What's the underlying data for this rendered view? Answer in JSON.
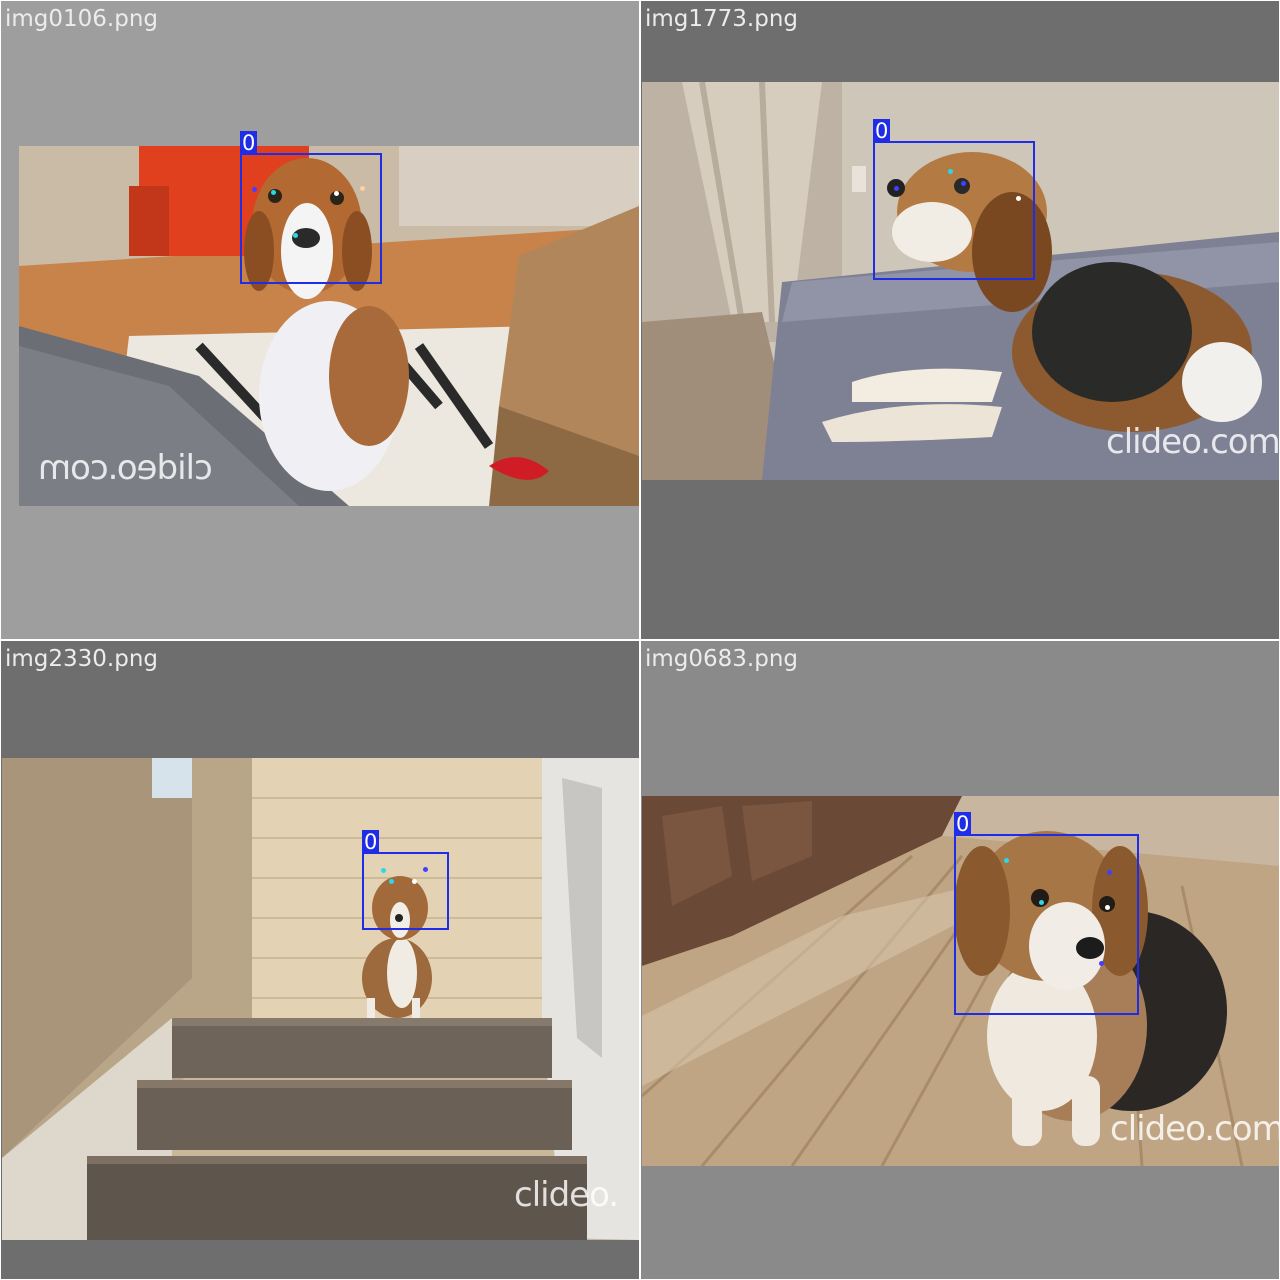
{
  "panels": [
    {
      "filename": "img0106.png",
      "watermark": "clideo.com",
      "detection_label": "0",
      "keypoint_colors": [
        "#2ad8e8",
        "#ffffff",
        "#4040ff",
        "#ffd0a0"
      ]
    },
    {
      "filename": "img1773.png",
      "watermark": "clideo.com",
      "detection_label": "0",
      "keypoint_colors": [
        "#2ad8e8",
        "#ffffff",
        "#4040ff"
      ]
    },
    {
      "filename": "img2330.png",
      "watermark": "clideo.",
      "detection_label": "0",
      "keypoint_colors": [
        "#2ad8e8",
        "#ffffff",
        "#4040ff"
      ]
    },
    {
      "filename": "img0683.png",
      "watermark": "clideo.com",
      "detection_label": "0",
      "keypoint_colors": [
        "#2ad8e8",
        "#ffffff",
        "#4040ff"
      ]
    }
  ],
  "colors": {
    "bbox": "#1f2ee6",
    "label_text": "#ffffff"
  }
}
